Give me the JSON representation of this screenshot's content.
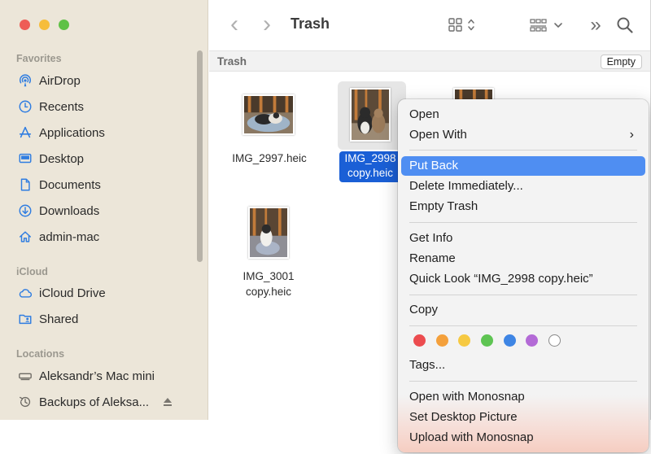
{
  "window": {
    "title": "Trash"
  },
  "sidebar": {
    "sections": [
      {
        "label": "Favorites",
        "items": [
          {
            "label": "AirDrop",
            "icon": "airdrop-icon"
          },
          {
            "label": "Recents",
            "icon": "clock-icon"
          },
          {
            "label": "Applications",
            "icon": "applications-icon"
          },
          {
            "label": "Desktop",
            "icon": "desktop-icon"
          },
          {
            "label": "Documents",
            "icon": "document-icon"
          },
          {
            "label": "Downloads",
            "icon": "download-icon"
          },
          {
            "label": "admin-mac",
            "icon": "home-icon"
          }
        ]
      },
      {
        "label": "iCloud",
        "items": [
          {
            "label": "iCloud Drive",
            "icon": "cloud-icon"
          },
          {
            "label": "Shared",
            "icon": "shared-folder-icon"
          }
        ]
      },
      {
        "label": "Locations",
        "items": [
          {
            "label": "Aleksandr’s Mac mini",
            "icon": "computer-icon"
          },
          {
            "label": "Backups of Aleksa...",
            "icon": "time-machine-icon"
          }
        ]
      }
    ]
  },
  "toolbar": {
    "back": "‹",
    "forward": "›",
    "more": "»"
  },
  "pathbar": {
    "title": "Trash",
    "empty_label": "Empty"
  },
  "files": [
    {
      "name": "IMG_2997.heic"
    },
    {
      "name_line1": "IMG_2998",
      "name_line2": "copy.heic"
    },
    {
      "name_line1": "IMG_3001",
      "name_line2": "copy.heic"
    }
  ],
  "context_menu": {
    "items": [
      {
        "label": "Open"
      },
      {
        "label": "Open With",
        "submenu": "›"
      },
      {
        "label": "Put Back",
        "highlighted": true
      },
      {
        "label": "Delete Immediately..."
      },
      {
        "label": "Empty Trash"
      },
      {
        "label": "Get Info"
      },
      {
        "label": "Rename"
      },
      {
        "label": "Quick Look “IMG_2998 copy.heic”"
      },
      {
        "label": "Copy"
      },
      {
        "label": "Tags..."
      },
      {
        "label": "Open with Monosnap"
      },
      {
        "label": "Set Desktop Picture"
      },
      {
        "label": "Upload with Monosnap"
      }
    ],
    "tag_colors": [
      "#ec4c4f",
      "#f4a03b",
      "#f6c942",
      "#5ec452",
      "#3e85e4",
      "#b36ad6",
      "#ffffff"
    ]
  },
  "colors": {
    "selection": "#1a5fd6",
    "menu_highlight": "#4f8ef2",
    "sidebar_bg": "#ece6d9",
    "sidebar_icon": "#2f7de1"
  }
}
